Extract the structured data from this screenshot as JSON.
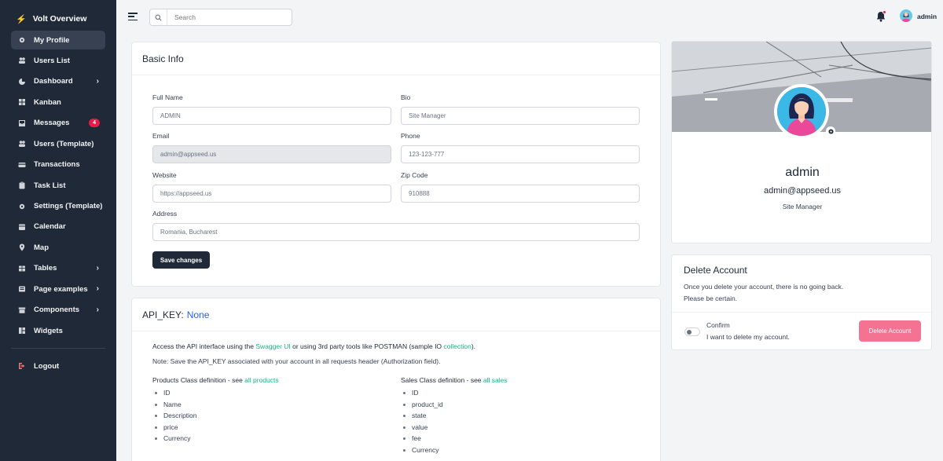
{
  "brand": {
    "name": "Volt Overview",
    "icon": "bolt-icon"
  },
  "sidebar": {
    "items": [
      {
        "label": "My Profile",
        "icon": "gear-icon",
        "active": true
      },
      {
        "label": "Users List",
        "icon": "users-icon"
      },
      {
        "label": "Dashboard",
        "icon": "chart-pie-icon",
        "chevron": true
      },
      {
        "label": "Kanban",
        "icon": "grid-icon"
      },
      {
        "label": "Messages",
        "icon": "inbox-icon",
        "badge": "4"
      },
      {
        "label": "Users (Template)",
        "icon": "users-icon"
      },
      {
        "label": "Transactions",
        "icon": "credit-card-icon"
      },
      {
        "label": "Task List",
        "icon": "clipboard-icon"
      },
      {
        "label": "Settings (Template)",
        "icon": "gear-icon"
      },
      {
        "label": "Calendar",
        "icon": "calendar-icon"
      },
      {
        "label": "Map",
        "icon": "location-icon"
      },
      {
        "label": "Tables",
        "icon": "table-icon",
        "chevron": true
      },
      {
        "label": "Page examples",
        "icon": "document-icon",
        "chevron": true
      },
      {
        "label": "Components",
        "icon": "archive-icon",
        "chevron": true
      },
      {
        "label": "Widgets",
        "icon": "widgets-icon"
      }
    ],
    "logout": "Logout"
  },
  "topbar": {
    "search_placeholder": "Search",
    "username": "admin"
  },
  "basic_info": {
    "title": "Basic Info",
    "fields": {
      "full_name": {
        "label": "Full Name",
        "value": "ADMIN"
      },
      "bio": {
        "label": "Bio",
        "value": "Site Manager"
      },
      "email": {
        "label": "Email",
        "value": "admin@appseed.us"
      },
      "phone": {
        "label": "Phone",
        "value": "123-123-777"
      },
      "website": {
        "label": "Website",
        "value": "https://appseed.us"
      },
      "zip": {
        "label": "Zip Code",
        "value": "910888"
      },
      "address": {
        "label": "Address",
        "value": "Romania, Bucharest"
      }
    },
    "save_label": "Save changes"
  },
  "api": {
    "title": "API_KEY:",
    "key": "None",
    "line1_a": "Access the API interface using the ",
    "line1_link1": "Swagger UI",
    "line1_b": " or using 3rd party tools like POSTMAN (sample IO ",
    "line1_link2": "collection",
    "line1_c": ").",
    "note": "Note: Save the API_KEY associated with your account in all requests header (Authorization field).",
    "products": {
      "heading": "Products Class definition - see ",
      "link": "all products",
      "items": [
        "ID",
        "Name",
        "Description",
        "price",
        "Currency"
      ]
    },
    "sales": {
      "heading": "Sales Class definition - see ",
      "link": "all sales",
      "items": [
        "ID",
        "product_id",
        "state",
        "value",
        "fee",
        "Currency"
      ]
    }
  },
  "profile": {
    "name": "admin",
    "email": "admin@appseed.us",
    "role": "Site Manager"
  },
  "delete_account": {
    "title": "Delete Account",
    "desc_1": "Once you delete your account, there is no going back.",
    "desc_2": "Please be certain.",
    "confirm_title": "Confirm",
    "confirm_sub": "I want to delete my account.",
    "button": "Delete Account"
  },
  "colors": {
    "sidebar_bg": "#1f2937",
    "accent_green": "#10b981",
    "danger": "#f47393",
    "badge": "#e11d48"
  }
}
